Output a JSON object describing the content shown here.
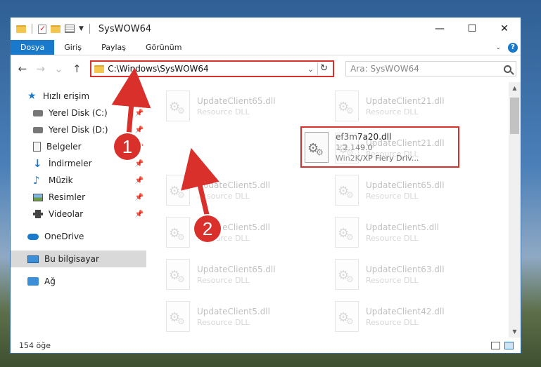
{
  "window": {
    "title": "SysWOW64"
  },
  "ribbon": {
    "tabs": [
      "Dosya",
      "Giriş",
      "Paylaş",
      "Görünüm"
    ]
  },
  "address": {
    "path": "C:\\Windows\\SysWOW64"
  },
  "search": {
    "placeholder": "Ara: SysWOW64"
  },
  "sidebar": {
    "quick_access": "Hızlı erişim",
    "items": [
      "Yerel Disk (C:)",
      "Yerel Disk (D:)",
      "Belgeler",
      "İndirmeler",
      "Müzik",
      "Resimler",
      "Videolar"
    ],
    "onedrive": "OneDrive",
    "this_pc": "Bu bilgisayar",
    "network": "Ağ"
  },
  "files": {
    "highlighted": {
      "name": "ef3m7a20.dll",
      "version": "1.2.149.0",
      "description": "Win2K/XP Fiery Driv..."
    },
    "faded": [
      {
        "name": "UpdateClient65.dll",
        "sub": "Resource DLL"
      },
      {
        "name": "UpdateClient21.dll",
        "sub": "Resource DLL"
      },
      {
        "name": "UpdateClient21.dll",
        "sub": "Resource DLL"
      },
      {
        "name": "UpdateClient5.dll",
        "sub": "Resource DLL"
      },
      {
        "name": "UpdateClient65.dll",
        "sub": "Resource DLL"
      },
      {
        "name": "UpdateClient5.dll",
        "sub": "Resource DLL"
      },
      {
        "name": "UpdateClient5.dll",
        "sub": "Resource DLL"
      },
      {
        "name": "UpdateClient65.dll",
        "sub": "Resource DLL"
      },
      {
        "name": "UpdateClient63.dll",
        "sub": "Resource DLL"
      },
      {
        "name": "UpdateClient5.dll",
        "sub": "Resource DLL"
      },
      {
        "name": "UpdateClient42.dll",
        "sub": "Resource DLL"
      }
    ]
  },
  "status": {
    "count": "154 öğe"
  },
  "callouts": {
    "one": "1",
    "two": "2"
  },
  "colors": {
    "accent": "#1979ca",
    "highlight": "#d9302c"
  }
}
